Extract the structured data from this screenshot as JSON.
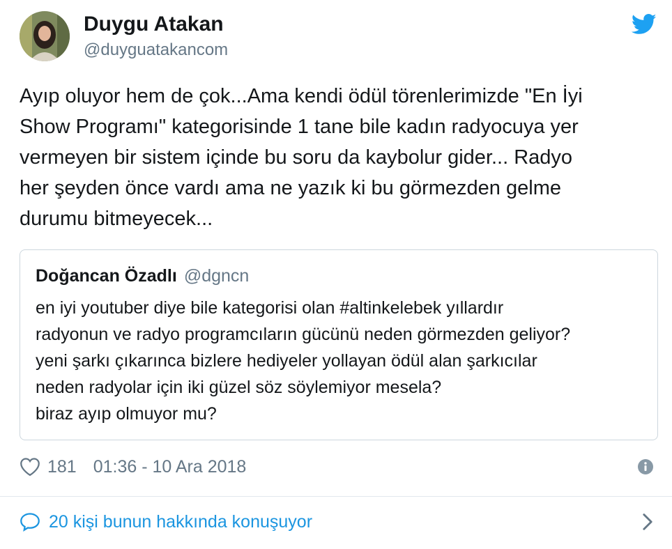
{
  "author": {
    "name": "Duygu Atakan",
    "handle": "@duyguatakancom"
  },
  "tweet": {
    "text": "Ayıp oluyor hem de çok...Ama kendi ödül törenlerimizde \"En İyi\nShow Programı\" kategorisinde 1 tane bile kadın radyocuya yer\nvermeyen bir sistem içinde bu soru da kaybolur gider... Radyo\nher şeyden önce vardı ama ne yazık ki bu görmezden gelme\ndurumu bitmeyecek..."
  },
  "quoted_tweet": {
    "name": "Doğancan Özadlı",
    "handle": "@dgncn",
    "text": "en iyi youtuber diye bile kategorisi olan #altinkelebek yıllardır\nradyonun ve radyo programcıların gücünü neden görmezden geliyor?\nyeni şarkı çıkarınca bizlere hediyeler yollayan ödül alan şarkıcılar\nneden radyolar için iki güzel söz söylemiyor mesela?\nbiraz ayıp olmuyor mu?"
  },
  "meta": {
    "likes": "181",
    "timestamp": "01:36 - 10 Ara 2018"
  },
  "footer": {
    "conversation_label": "20 kişi bunun hakkında konuşuyor"
  },
  "icons": {
    "bird": "twitter-bird-icon",
    "heart": "heart-icon",
    "info": "info-icon",
    "reply": "speech-bubble-icon",
    "chevron": "chevron-right-icon"
  },
  "colors": {
    "brand_blue": "#1da1f2",
    "link_blue": "#1b95e0",
    "secondary_text": "#657786",
    "border": "#ccd6dd"
  }
}
